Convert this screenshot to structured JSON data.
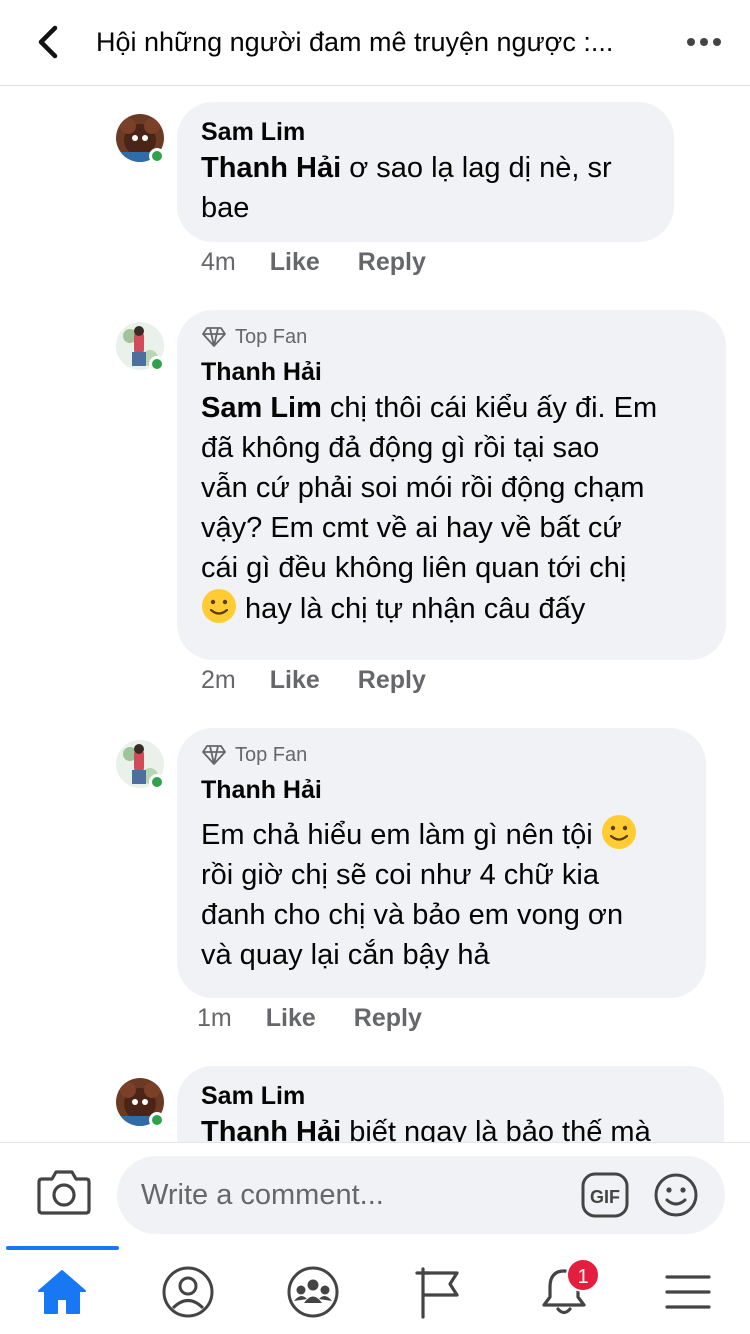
{
  "header": {
    "title": "Hội những người đam mê truyện ngược :..."
  },
  "comments": [
    {
      "author": "Sam Lim",
      "top_fan": false,
      "mention": "Thanh Hải",
      "text_line1": " ơ sao lạ lag dị nè, sr",
      "text_line2": "bae",
      "time": "4m",
      "like_label": "Like",
      "reply_label": "Reply"
    },
    {
      "badge": "Top Fan",
      "author": "Thanh Hải",
      "mention": "Sam Lim",
      "text_line1": " chị thôi cái kiểu ấy đi. Em",
      "text_line2": "đã không đả động gì rồi tại sao",
      "text_line3": "vẫn cứ phải soi mói rồi động chạm",
      "text_line4": "vậy? Em cmt về ai hay về bất cứ",
      "text_line5": "cái gì đều không liên quan tới chị",
      "text_line6": " hay là chị tự nhận câu đấy",
      "time": "2m",
      "like_label": "Like",
      "reply_label": "Reply"
    },
    {
      "badge": "Top Fan",
      "author": "Thanh Hải",
      "text_line1": "Em chả hiểu em làm gì nên tội",
      "text_line2": "rồi giờ chị sẽ coi như 4 chữ kia",
      "text_line3": "đanh cho chị và bảo em vong ơn",
      "text_line4": "và quay lại cắn bậy hả",
      "time": "1m",
      "like_label": "Like",
      "reply_label": "Reply"
    },
    {
      "author": "Sam Lim",
      "mention": "Thanh Hải",
      "text_line1": " biết ngay là bảo thế mà"
    }
  ],
  "composer": {
    "placeholder": "Write a comment...",
    "gif_label": "GIF"
  },
  "tabbar": {
    "notification_count": "1"
  },
  "colors": {
    "accent": "#1877f2",
    "bubble": "#f0f2f5",
    "online": "#31a24c",
    "badge": "#e41e3f"
  }
}
